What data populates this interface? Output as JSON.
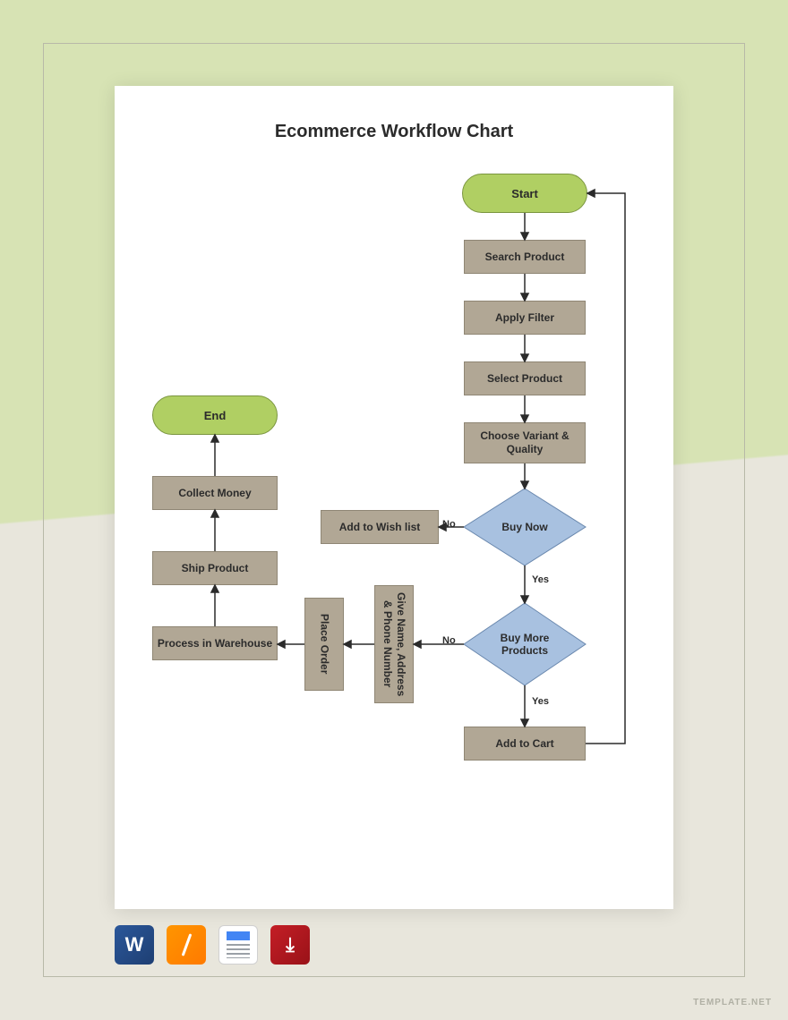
{
  "title": "Ecommerce Workflow Chart",
  "nodes": {
    "start": "Start",
    "end": "End",
    "search": "Search Product",
    "filter": "Apply Filter",
    "select": "Select Product",
    "variant": "Choose Variant & Quality",
    "buynow": "Buy Now",
    "buymore": "Buy More Products",
    "addcart": "Add to Cart",
    "wishlist": "Add to Wish list",
    "givename": "Give Name, Address & Phone Number",
    "placeorder": "Place Order",
    "warehouse": "Process in Warehouse",
    "ship": "Ship Product",
    "collect": "Collect Money"
  },
  "labels": {
    "yes": "Yes",
    "no": "No"
  },
  "watermark": "TEMPLATE.NET",
  "icons": [
    "word",
    "pages",
    "docs",
    "pdf"
  ]
}
